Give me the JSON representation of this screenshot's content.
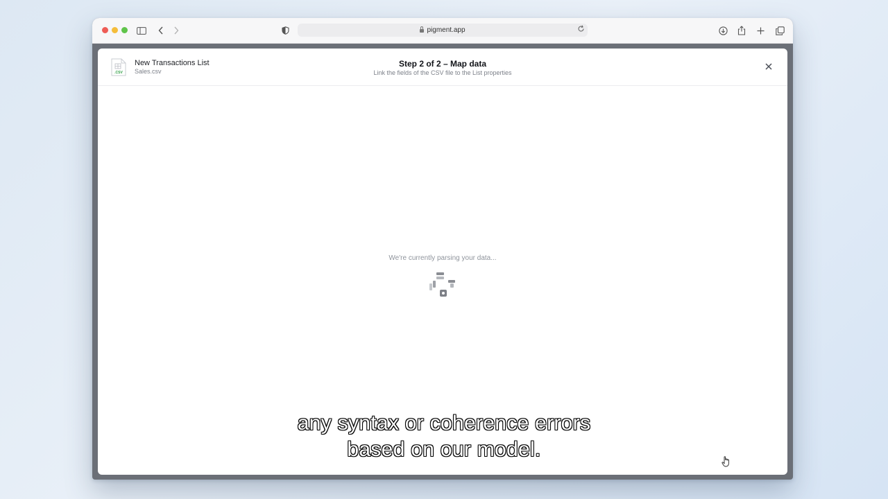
{
  "browser": {
    "url": "pigment.app"
  },
  "modal": {
    "list_title": "New Transactions List",
    "file_name": "Sales.csv",
    "file_ext": ".CSV",
    "step_title": "Step 2 of 2 – Map data",
    "step_subtitle": "Link the fields of the CSV file to the List properties",
    "parsing_message": "We're currently parsing your data..."
  },
  "caption": {
    "line1": "any syntax or coherence errors",
    "line2": "based on our model."
  },
  "colors": {
    "accent_green": "#2f9e44",
    "close_icon": "#4a4e57"
  }
}
